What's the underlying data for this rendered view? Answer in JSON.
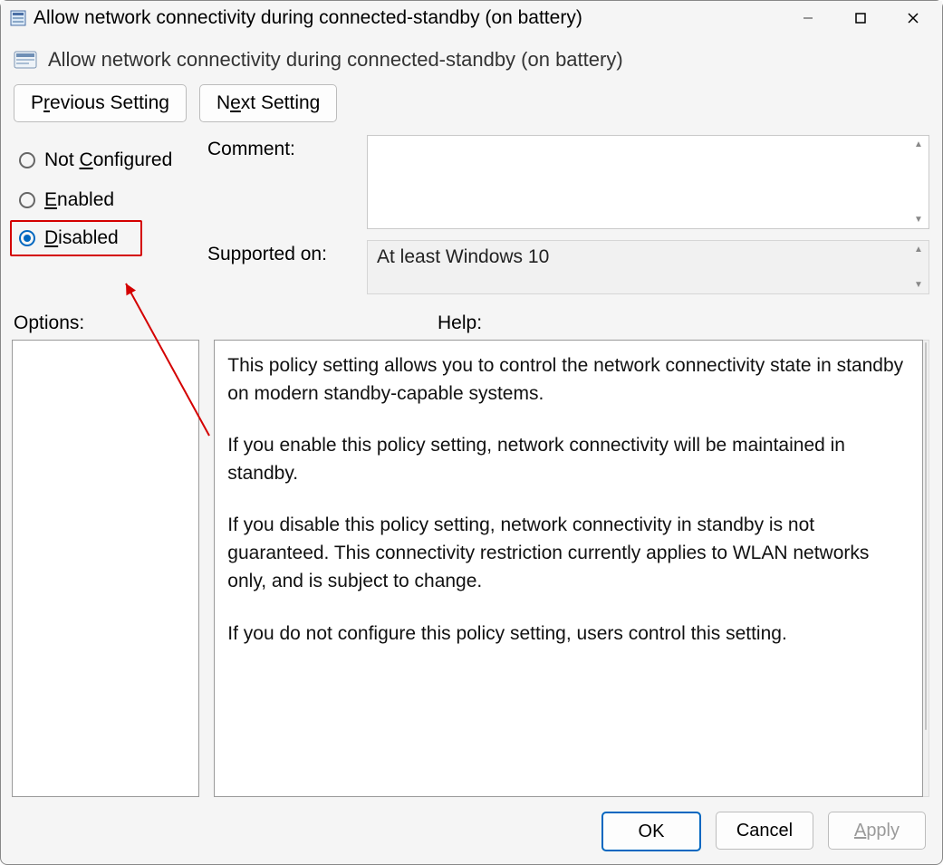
{
  "window": {
    "title": "Allow network connectivity during connected-standby (on battery)"
  },
  "header": {
    "policy_title": "Allow network connectivity during connected-standby (on battery)"
  },
  "nav": {
    "prev_pre": "P",
    "prev_accel": "r",
    "prev_post": "evious Setting",
    "next_pre": "N",
    "next_accel": "e",
    "next_post": "xt Setting"
  },
  "state": {
    "not_configured_pre": "Not ",
    "not_configured_accel": "C",
    "not_configured_post": "onfigured",
    "enabled_accel": "E",
    "enabled_post": "nabled",
    "disabled_accel": "D",
    "disabled_post": "isabled",
    "selected": "disabled"
  },
  "fields": {
    "comment_label": "Comment:",
    "comment_value": "",
    "supported_label": "Supported on:",
    "supported_value": "At least Windows 10"
  },
  "panes": {
    "options_label": "Options:",
    "help_label": "Help:",
    "help_paragraphs": [
      "This policy setting allows you to control the network connectivity state in standby on modern standby-capable systems.",
      "If you enable this policy setting, network connectivity will be maintained in standby.",
      "If you disable this policy setting, network connectivity in standby is not guaranteed. This connectivity restriction currently applies to WLAN networks only, and is subject to change.",
      "If you do not configure this policy setting, users control this setting."
    ]
  },
  "footer": {
    "ok": "OK",
    "cancel": "Cancel",
    "apply_accel": "A",
    "apply_post": "pply"
  },
  "annotation": {
    "highlight_target": "disabled-radio"
  }
}
